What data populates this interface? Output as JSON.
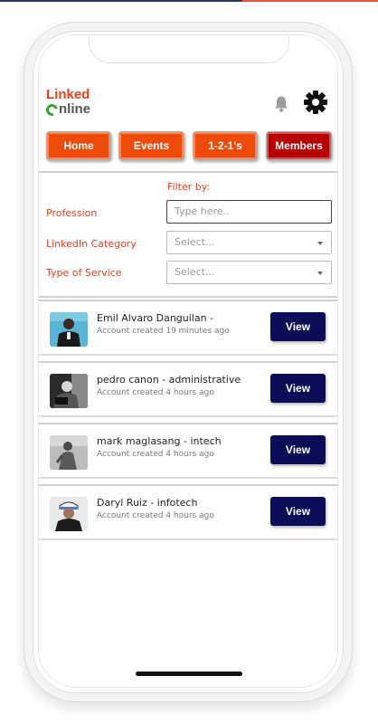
{
  "logo": {
    "line1": "Linked",
    "line2": "nline"
  },
  "header": {
    "bell_icon": "bell-icon",
    "settings_icon": "gear-icon"
  },
  "nav": {
    "items": [
      {
        "label": "Home"
      },
      {
        "label": "Events"
      },
      {
        "label": "1-2-1's"
      },
      {
        "label": "Members"
      }
    ]
  },
  "filter": {
    "title": "Filter by:",
    "profession": {
      "label": "Profession",
      "placeholder": "Type here.."
    },
    "category": {
      "label": "LinkedIn Category",
      "value": "Select..."
    },
    "service": {
      "label": "Type of Service",
      "value": "Select..."
    }
  },
  "members": [
    {
      "name": "Emil Alvaro Danguilan -",
      "created": "Account created 19 minutes ago",
      "action": "View"
    },
    {
      "name": "pedro canon - administrative",
      "created": "Account created 4 hours ago",
      "action": "View"
    },
    {
      "name": "mark maglasang - intech",
      "created": "Account created 4 hours ago",
      "action": "View"
    },
    {
      "name": "Daryl Ruiz - infotech",
      "created": "Account created 4 hours ago",
      "action": "View"
    }
  ],
  "colors": {
    "brand_orange": "#ee4a0c",
    "active_red": "#b80000",
    "view_navy": "#0b0e57",
    "label_red": "#e8401c"
  }
}
